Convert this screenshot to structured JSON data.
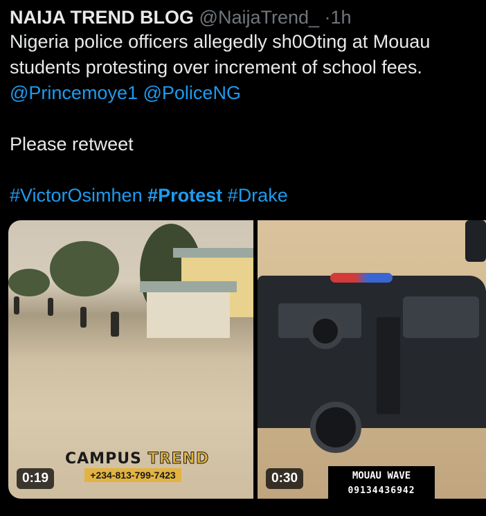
{
  "tweet": {
    "author_name": "NAIJA TREND BLOG",
    "handle": "@NaijaTrend_",
    "separator": "·",
    "time": "1h",
    "text_line1": "Nigeria police officers allegedly sh0Oting at Mouau",
    "text_line2": "students protesting over increment of school fees.",
    "mentions": [
      "@Princemoye1",
      "@PoliceNG"
    ],
    "retweet_line": "Please retweet",
    "hashtags": [
      "#VictorOsimhen",
      "#Protest",
      "#Drake"
    ]
  },
  "media": {
    "video1": {
      "duration": "0:19",
      "watermark_title_1": "CAMPUS",
      "watermark_title_2": "TREND",
      "watermark_phone": "+234-813-799-7423"
    },
    "video2": {
      "duration": "0:30",
      "watermark_title": "MOUAU WAVE",
      "watermark_phone": "09134436942"
    }
  },
  "colors": {
    "background": "#000000",
    "text": "#e7e9ea",
    "muted": "#71767b",
    "link": "#1d9bf0"
  }
}
